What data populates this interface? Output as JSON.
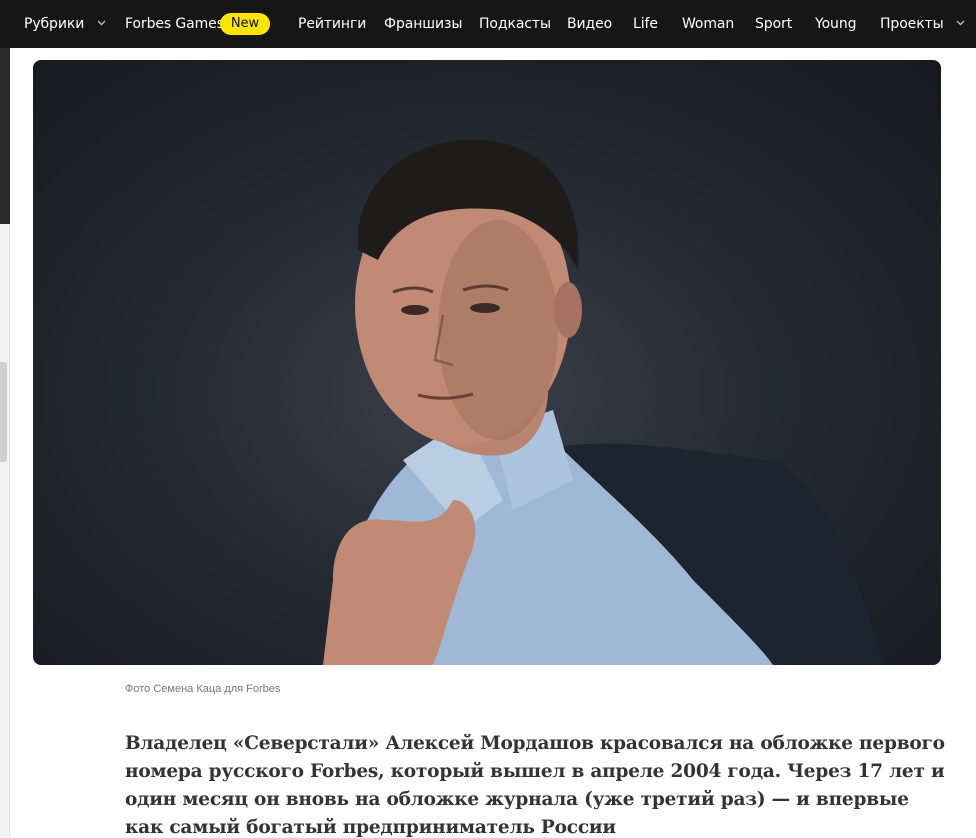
{
  "nav": {
    "rubrics": "Рубрики",
    "forbes_games": "Forbes Games",
    "new_badge": "New",
    "ratings": "Рейтинги",
    "franchises": "Франшизы",
    "podcasts": "Подкасты",
    "video": "Видео",
    "life": "Life",
    "woman": "Woman",
    "sport": "Sport",
    "young": "Young",
    "projects": "Проекты",
    "badge_color": "#ffe500",
    "bg_color": "#161616"
  },
  "article": {
    "photo_caption": "Фото Семена Каца для Forbes",
    "lead": "Владелец «Северстали» Алексей Мордашов красовался на обложке первого номера русского Forbes, который вышел в апреле 2004 года. Через 17 лет и один месяц он вновь на обложке журнала (уже третий раз) — и впервые как самый богатый предприниматель России"
  }
}
